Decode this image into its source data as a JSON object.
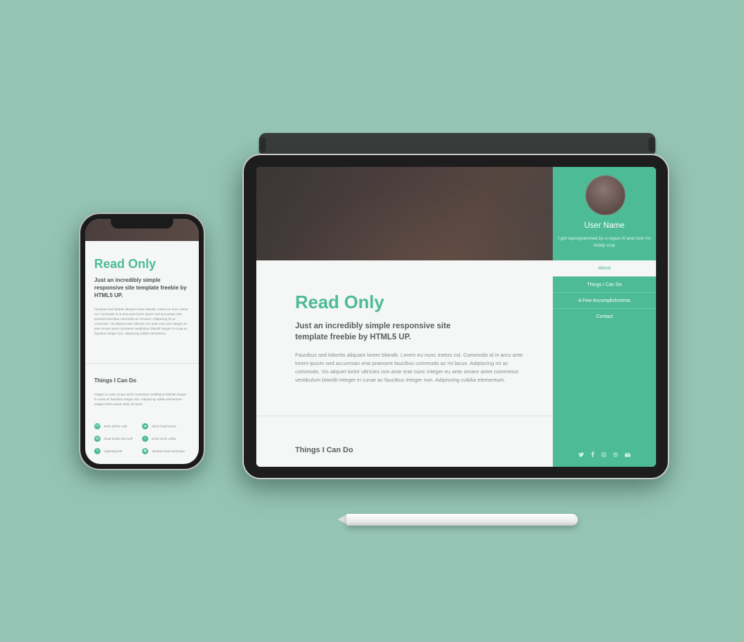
{
  "colors": {
    "background": "#95c4b4",
    "accent": "#4cbb96",
    "panel": "#f5f6f6",
    "text_dark": "#5b5d5d",
    "text_light": "#8a8d8d"
  },
  "site": {
    "title": "Read Only",
    "subtitle_tablet": "Just an incredibly simple responsive site template freebie by HTML5 UP.",
    "subtitle_phone": "Just an incredibly simple responsive site template freebie by HTML5 UP.",
    "body": "Faucibus sed lobortis aliquam lorem blandit. Lorem eu nunc metus col. Commodo id in arcu ante lorem ipsum sed accumsan erat praesent faucibus commodo ac mi lacus. Adipiscing mi ac commodo. Vis aliquet tortor ultricies non ante erat nunc integer eu ante ornare amet commetus vestibulum blandit integer in curae ac faucibus integer non. Adipiscing cubilia elementum.",
    "section_things": "Things I Can Do",
    "things_text": "Integer eu ante ornare amet commetus vestibulum blandit integer in curae ac faucibus integer non. Adipiscing cubilia elementum integer lorem ipsum dolor sit amet."
  },
  "sidebar": {
    "user_name": "User Name",
    "tagline": "I got reprogrammed by a rogue AI and now I'm totally cray",
    "nav": [
      {
        "label": "About",
        "active": true
      },
      {
        "label": "Things I Can Do",
        "active": false
      },
      {
        "label": "A Few Accomplishments",
        "active": false
      },
      {
        "label": "Contact",
        "active": false
      }
    ],
    "social_icons": [
      "twitter-icon",
      "facebook-icon",
      "instagram-icon",
      "github-icon",
      "email-icon"
    ]
  },
  "phone_features": [
    {
      "icon": "code-icon",
      "glyph": "</>",
      "label": "Write all the code"
    },
    {
      "icon": "cloud-icon",
      "glyph": "☁",
      "label": "Stack small boxes"
    },
    {
      "icon": "book-icon",
      "glyph": "▤",
      "label": "Read books and stuff"
    },
    {
      "icon": "coffee-icon",
      "glyph": "♨",
      "label": "Drink much coffee"
    },
    {
      "icon": "lightning-icon",
      "glyph": "ϟ",
      "label": "Lightning bolt"
    },
    {
      "icon": "shield-icon",
      "glyph": "◉",
      "label": "Shadow clone technique"
    }
  ]
}
